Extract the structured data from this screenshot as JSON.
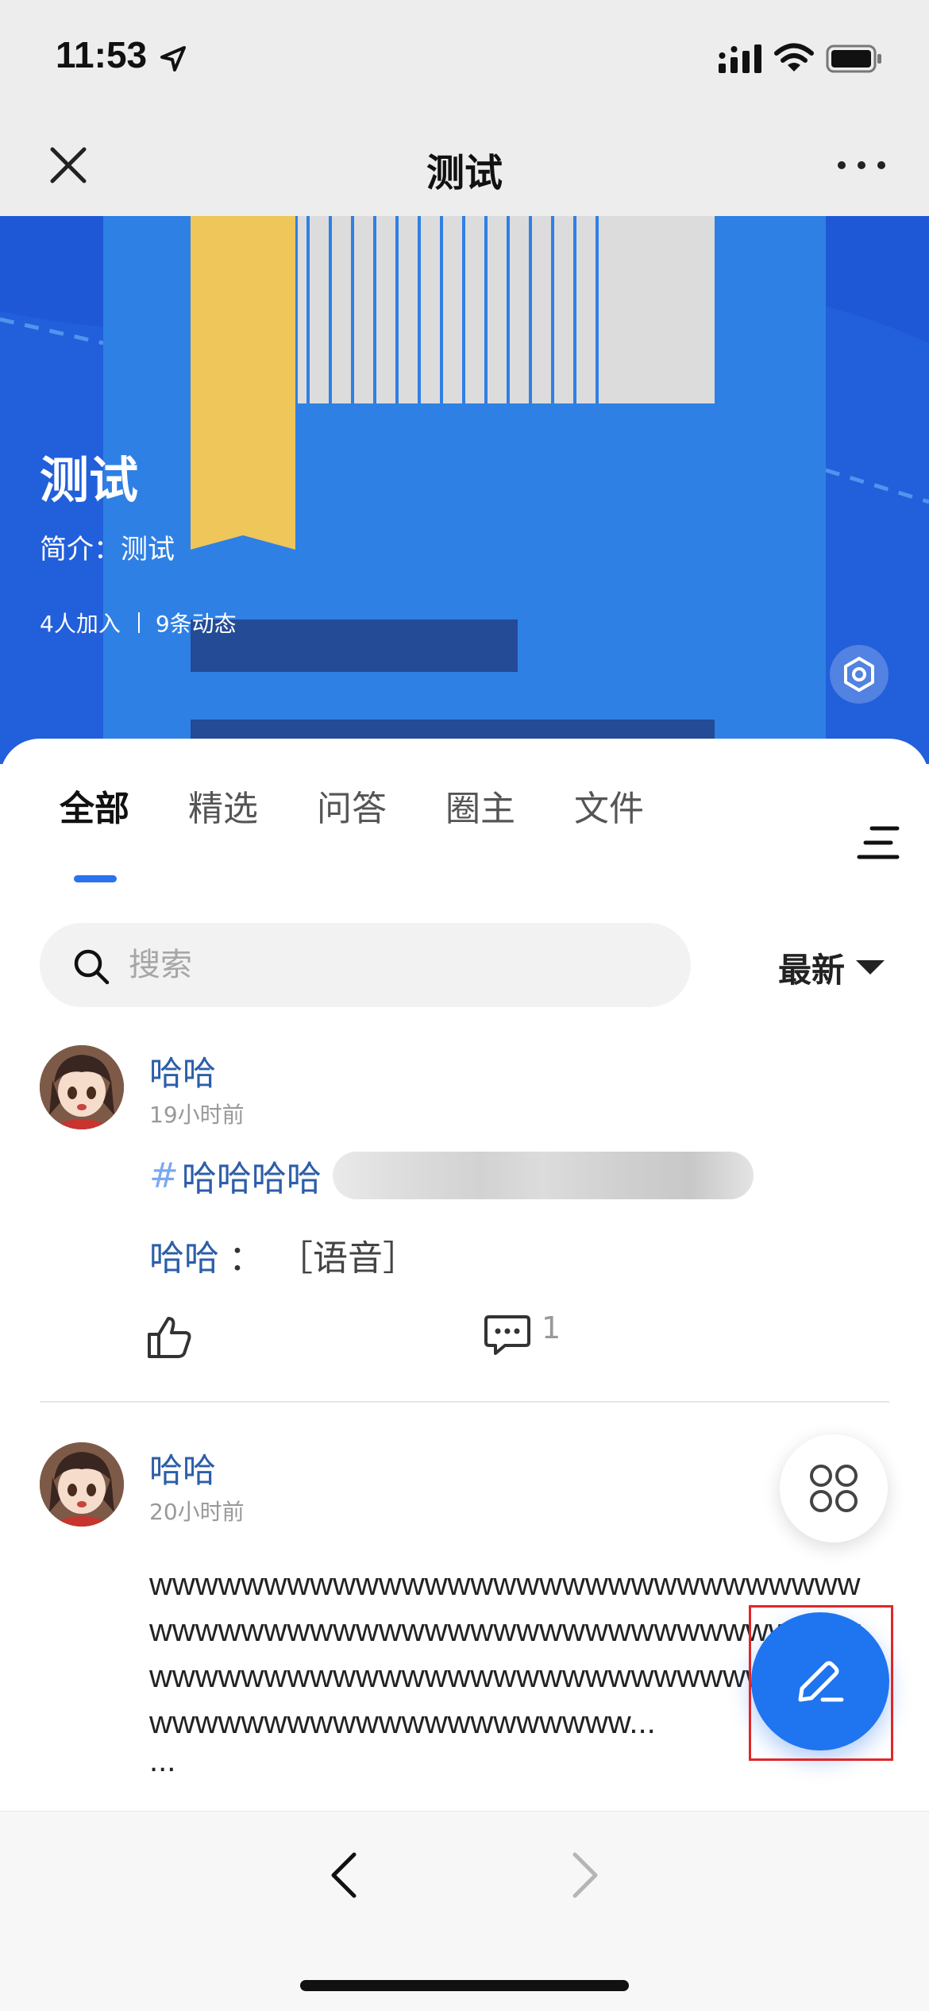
{
  "status_bar": {
    "time": "11:53"
  },
  "nav": {
    "title": "测试",
    "icons": [
      "close-icon",
      "more-icon"
    ]
  },
  "hero": {
    "title": "测试",
    "description": "简介：测试",
    "members": "4人加入",
    "posts": "9条动态"
  },
  "tabs": [
    {
      "label": "全部",
      "active": true
    },
    {
      "label": "精选",
      "active": false
    },
    {
      "label": "问答",
      "active": false
    },
    {
      "label": "圈主",
      "active": false
    },
    {
      "label": "文件",
      "active": false
    }
  ],
  "search": {
    "placeholder": "搜索",
    "value": ""
  },
  "sort": {
    "label": "最新"
  },
  "posts": [
    {
      "author": "哈哈",
      "time": "19小时前",
      "topic_hash": "#",
      "topic": "哈哈哈哈",
      "reply_name": "哈哈",
      "reply_colon": "：",
      "reply_text": "［语音］",
      "comment_count": "1"
    },
    {
      "author": "哈哈",
      "time": "20小时前",
      "body": "wwwwwwwwwwwwwwwwwwwwwwwwwwwwwwwwwwwwwwwwwwwwwwwwwwwwwwwwwwwwwwwwwwwwwwwwwwwwwwwwwwwwwwwwwwwwwwwwwwwwwwwwwwwwwwwwww...",
      "ellipsis": "..."
    }
  ],
  "colors": {
    "accent": "#1f74f0",
    "link": "#2c5ea8",
    "hero": "#1f58d6",
    "highlight_box": "#e0262a"
  }
}
